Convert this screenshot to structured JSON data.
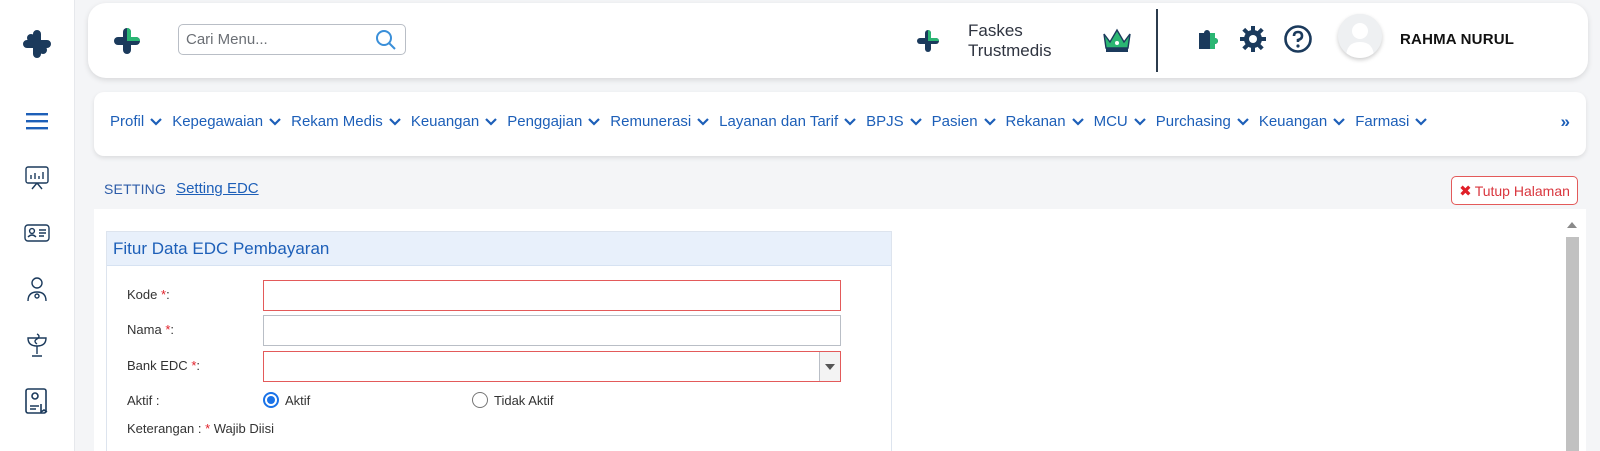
{
  "header": {
    "search_placeholder": "Cari Menu...",
    "faskes_line1": "Faskes",
    "faskes_line2": "Trustmedis",
    "user_name": "RAHMA NURUL"
  },
  "menu": {
    "items": [
      "Profil",
      "Kepegawaian",
      "Rekam Medis",
      "Keuangan",
      "Penggajian",
      "Remunerasi",
      "Layanan dan Tarif",
      "BPJS",
      "Pasien",
      "Rekanan",
      "MCU",
      "Purchasing",
      "Keuangan",
      "Farmasi"
    ],
    "more": "»"
  },
  "breadcrumb": {
    "root": "SETTING",
    "current": "Setting EDC"
  },
  "close_button": {
    "label": "Tutup Halaman",
    "icon": "✖"
  },
  "form": {
    "title": "Fitur Data EDC Pembayaran",
    "required_mark": "*",
    "fields": {
      "kode": {
        "label": "Kode",
        "suffix": ":",
        "value": ""
      },
      "nama": {
        "label": "Nama",
        "suffix": ":",
        "value": ""
      },
      "bank_edc": {
        "label": "Bank EDC",
        "suffix": ":",
        "value": ""
      },
      "aktif": {
        "label": "Aktif :"
      }
    },
    "radio_options": [
      {
        "label": "Aktif",
        "checked": true
      },
      {
        "label": "Tidak Aktif",
        "checked": false
      }
    ],
    "note_label": "Keterangan :",
    "note_text": "Wajib Diisi"
  },
  "colors": {
    "brand_navy": "#1b3a5c",
    "brand_green": "#2bb673",
    "link_blue": "#1d5fb8",
    "error_red": "#e01f28"
  }
}
